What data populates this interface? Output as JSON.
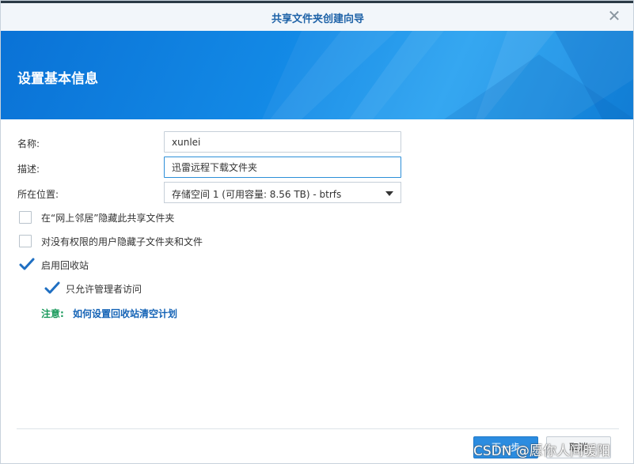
{
  "dialog": {
    "title": "共享文件夹创建向导",
    "close_glyph": "✕"
  },
  "banner": {
    "title": "设置基本信息"
  },
  "form": {
    "name_label": "名称:",
    "name_value": "xunlei",
    "desc_label": "描述:",
    "desc_value": "迅雷远程下载文件夹",
    "location_label": "所在位置:",
    "location_value": "存储空间 1 (可用容量:  8.56 TB) - btrfs"
  },
  "options": [
    {
      "label": "在“网上邻居”隐藏此共享文件夹",
      "checked": false
    },
    {
      "label": "对没有权限的用户隐藏子文件夹和文件",
      "checked": false
    },
    {
      "label": "启用回收站",
      "checked": true
    },
    {
      "label": "只允许管理者访问",
      "checked": true
    }
  ],
  "note": {
    "prefix": "注意:",
    "link_text": "如何设置回收站清空计划"
  },
  "footer": {
    "next_label": "下一步",
    "cancel_label": "取消"
  },
  "watermark": "CSDN @愿你人间暖阳",
  "colors": {
    "accent": "#2b8ce0",
    "banner": "#138ae6",
    "link": "#1463b6",
    "note": "#1a9a5c",
    "check": "#1f6fc2"
  }
}
